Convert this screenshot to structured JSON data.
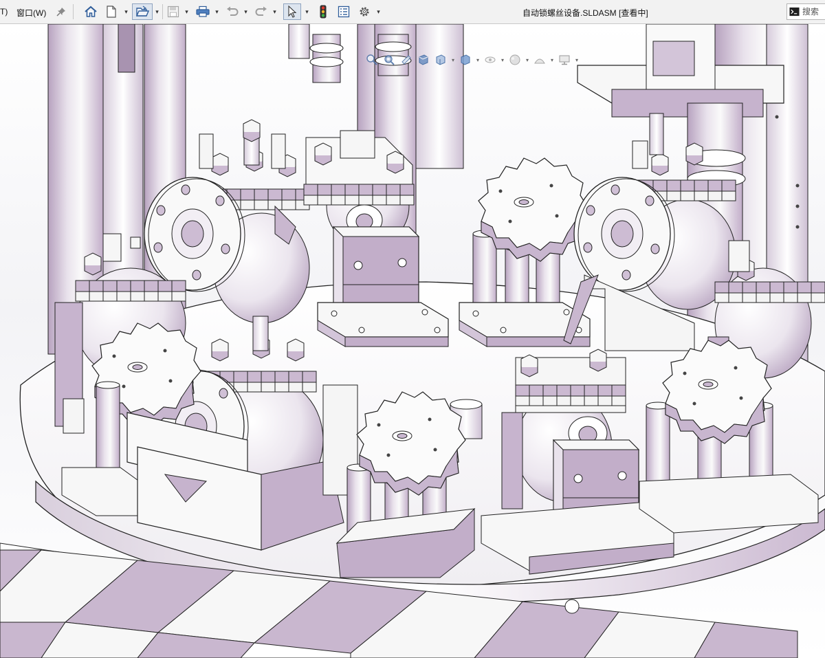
{
  "menu": {
    "partial_item_label": "T)",
    "window_menu_label": "窗口(W)"
  },
  "window": {
    "title": "自动锁螺丝设备.SLDASM [查看中]"
  },
  "search": {
    "placeholder": "搜索"
  },
  "toolbar": {
    "buttons": [
      {
        "name": "pin-icon",
        "dropdown": false
      },
      {
        "name": "home-icon",
        "dropdown": false
      },
      {
        "name": "new-document-icon",
        "dropdown": true
      },
      {
        "name": "open-icon",
        "dropdown": true
      },
      {
        "name": "save-icon",
        "dropdown": true
      },
      {
        "name": "print-icon",
        "dropdown": true
      },
      {
        "name": "undo-icon",
        "dropdown": true
      },
      {
        "name": "redo-icon",
        "dropdown": true
      },
      {
        "name": "select-icon",
        "dropdown": true
      },
      {
        "name": "traffic-light-icon",
        "dropdown": false
      },
      {
        "name": "file-properties-icon",
        "dropdown": false
      },
      {
        "name": "options-gear-icon",
        "dropdown": true
      }
    ]
  },
  "heads_up_toolbar": {
    "buttons": [
      "zoom-to-fit-icon",
      "zoom-area-icon",
      "previous-view-icon",
      "section-view-icon",
      "view-orientation-icon",
      "display-style-icon",
      "hide-show-items-icon",
      "edit-appearance-icon",
      "apply-scene-icon",
      "view-settings-icon"
    ]
  },
  "colors": {
    "toolbar_bg": "#f2f2f2",
    "model_lilac": "#c4b0cb",
    "model_white": "#f8f8f8",
    "edge": "#1a1a1a",
    "background_top": "#ffffff",
    "background_bottom": "#e8e8ee"
  }
}
